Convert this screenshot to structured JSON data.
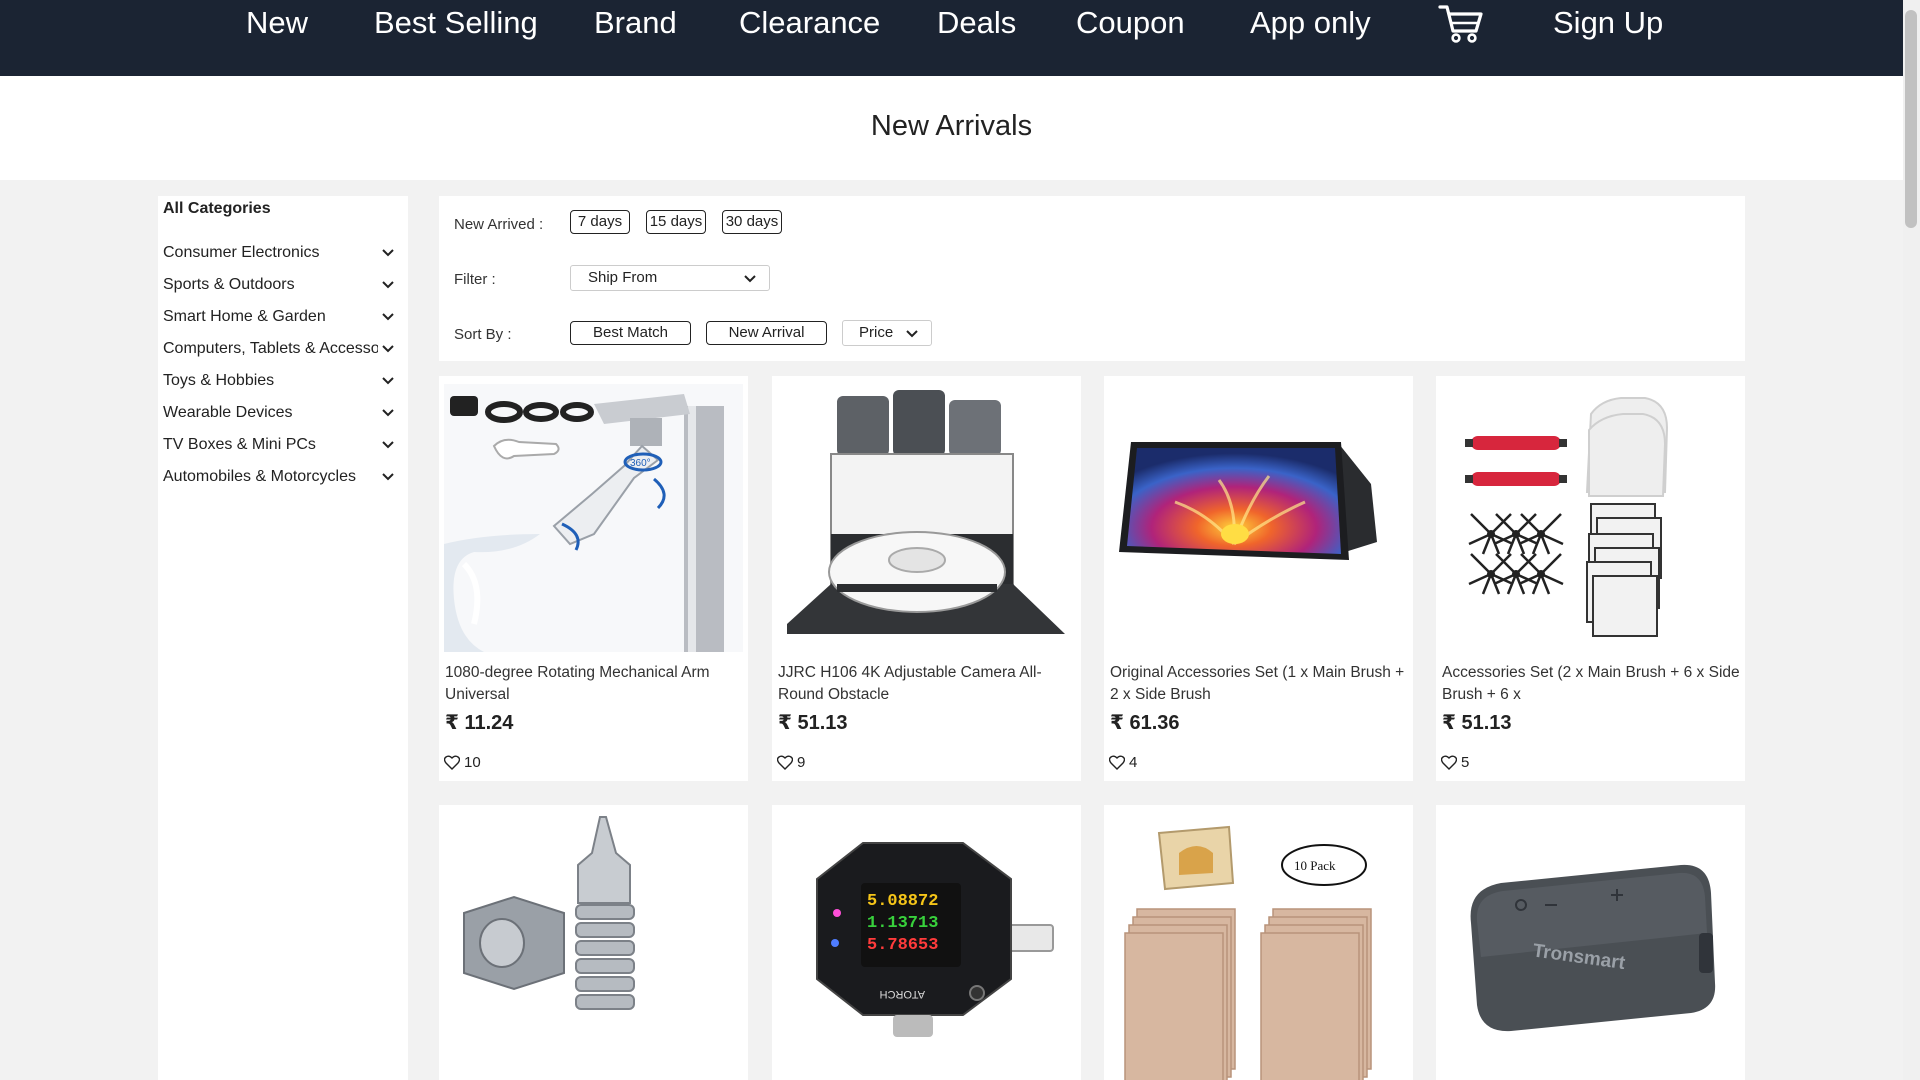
{
  "nav": {
    "items": [
      "New",
      "Best Selling",
      "Brand",
      "Clearance",
      "Deals",
      "Coupon",
      "App only"
    ],
    "cart_icon": "shopping-cart-icon",
    "signup": "Sign Up"
  },
  "page_title": "New Arrivals",
  "sidebar": {
    "title": "All Categories",
    "categories": [
      "Consumer Electronics",
      "Sports & Outdoors",
      "Smart Home & Garden",
      "Computers, Tablets & Accessories",
      "Toys & Hobbies",
      "Wearable Devices",
      "TV Boxes & Mini PCs",
      "Automobiles & Motorcycles"
    ]
  },
  "filters": {
    "new_arrived_label": "New Arrived :",
    "new_arrived_options": [
      "7 days",
      "15 days",
      "30 days"
    ],
    "filter_label": "Filter :",
    "ship_from": "Ship From",
    "sort_label": "Sort By :",
    "sort_options": [
      "Best Match",
      "New Arrival"
    ],
    "price_sort": "Price"
  },
  "products": [
    {
      "name": "1080-degree Rotating Mechanical Arm Universal",
      "price": "₹ 11.24",
      "likes": "10"
    },
    {
      "name": "JJRC H106 4K Adjustable Camera All-Round Obstacle",
      "price": "₹ 51.13",
      "likes": "9"
    },
    {
      "name": "Original Accessories Set (1 x Main Brush + 2 x Side Brush",
      "price": "₹ 61.36",
      "likes": "4"
    },
    {
      "name": "Accessories Set (2 x Main Brush + 6 x Side Brush + 6 x",
      "price": "₹ 51.13",
      "likes": "5"
    }
  ],
  "image_text": {
    "rotate_badge": "360°",
    "tester_readings": [
      "5.08872",
      "1.13713",
      "5.78653"
    ],
    "tester_brand": "ATORCH",
    "pack_badge": "10 Pack",
    "speaker_brand": "Tronsmart"
  },
  "colors": {
    "nav_bg": "#1b2433",
    "page_bg": "#f2f2f2",
    "card_bg": "#ffffff"
  }
}
